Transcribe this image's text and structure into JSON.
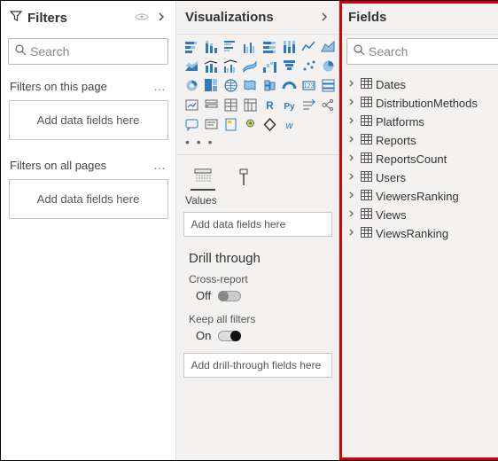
{
  "filters": {
    "title": "Filters",
    "search_placeholder": "Search",
    "section_page": "Filters on this page",
    "section_all": "Filters on all pages",
    "drop_hint": "Add data fields here"
  },
  "visualizations": {
    "title": "Visualizations",
    "values_label": "Values",
    "values_drop_hint": "Add data fields here",
    "drill_title": "Drill through",
    "cross_report_label": "Cross-report",
    "cross_report_state": "Off",
    "keep_filters_label": "Keep all filters",
    "keep_filters_state": "On",
    "drill_drop_hint": "Add drill-through fields here"
  },
  "fields": {
    "title": "Fields",
    "search_placeholder": "Search",
    "tables": [
      "Dates",
      "DistributionMethods",
      "Platforms",
      "Reports",
      "ReportsCount",
      "Users",
      "ViewersRanking",
      "Views",
      "ViewsRanking"
    ]
  }
}
